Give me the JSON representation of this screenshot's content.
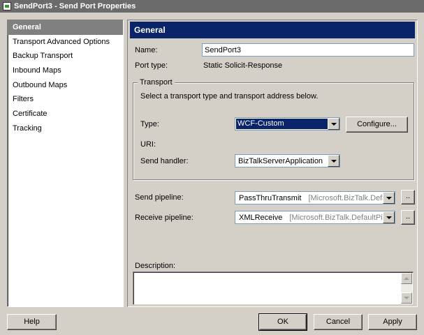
{
  "window": {
    "title": "SendPort3 - Send Port Properties"
  },
  "sidebar": {
    "items": [
      {
        "label": "General",
        "selected": true
      },
      {
        "label": "Transport Advanced Options"
      },
      {
        "label": "Backup Transport"
      },
      {
        "label": "Inbound Maps"
      },
      {
        "label": "Outbound Maps"
      },
      {
        "label": "Filters"
      },
      {
        "label": "Certificate"
      },
      {
        "label": "Tracking"
      }
    ]
  },
  "main": {
    "header": "General",
    "name_label": "Name:",
    "name_value": "SendPort3",
    "port_type_label": "Port type:",
    "port_type_value": "Static Solicit-Response",
    "transport": {
      "title": "Transport",
      "instruction": "Select a transport type and transport address below.",
      "type_label": "Type:",
      "type_value": "WCF-Custom",
      "configure_label": "Configure...",
      "uri_label": "URI:",
      "handler_label": "Send handler:",
      "handler_value": "BizTalkServerApplication"
    },
    "send_pipeline_label": "Send pipeline:",
    "send_pipeline_value": "PassThruTransmit",
    "send_pipeline_assembly": "[Microsoft.BizTalk.Defau",
    "receive_pipeline_label": "Receive pipeline:",
    "receive_pipeline_value": "XMLReceive",
    "receive_pipeline_assembly": "[Microsoft.BizTalk.DefaultPip",
    "ellipsis_label": "..",
    "description_label": "Description:"
  },
  "footer": {
    "help_label": "Help",
    "ok_label": "OK",
    "cancel_label": "Cancel",
    "apply_label": "Apply"
  },
  "colors": {
    "header_bg": "#0a246a",
    "selected_bg": "#808080",
    "dialog_bg": "#d4d0c8"
  }
}
